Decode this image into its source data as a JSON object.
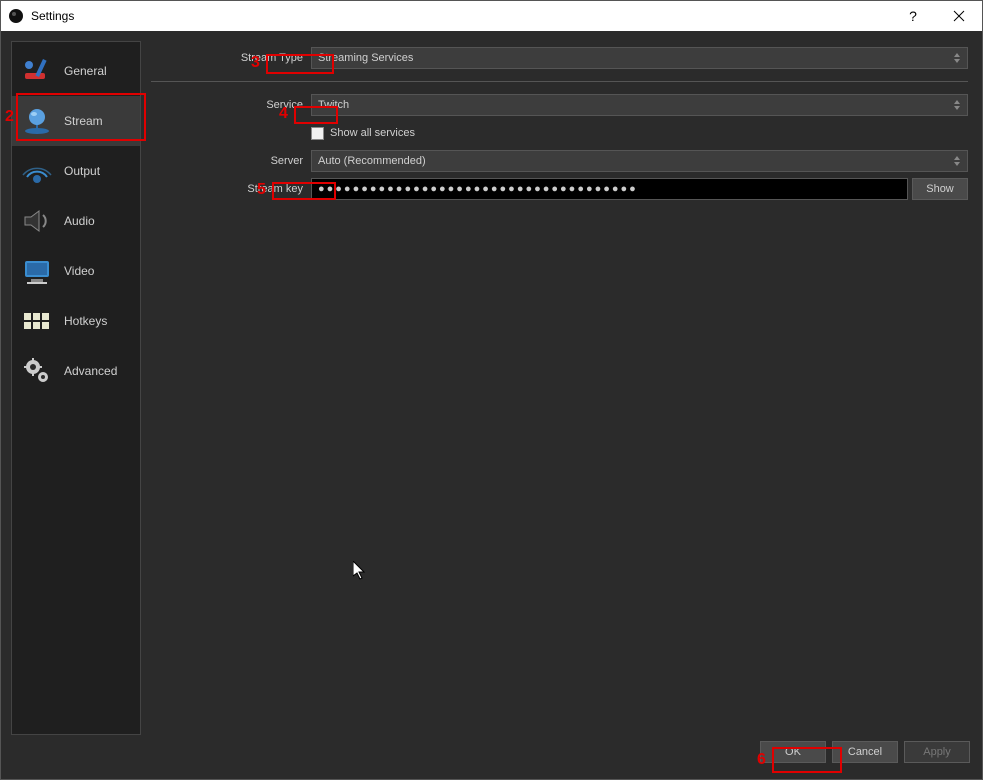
{
  "window": {
    "title": "Settings"
  },
  "sidebar": {
    "items": [
      {
        "label": "General"
      },
      {
        "label": "Stream"
      },
      {
        "label": "Output"
      },
      {
        "label": "Audio"
      },
      {
        "label": "Video"
      },
      {
        "label": "Hotkeys"
      },
      {
        "label": "Advanced"
      }
    ]
  },
  "form": {
    "stream_type_label": "Stream Type",
    "stream_type_value": "Streaming Services",
    "service_label": "Service",
    "service_value": "Twitch",
    "show_all_services_label": "Show all services",
    "server_label": "Server",
    "server_value": "Auto (Recommended)",
    "stream_key_label": "Stream key",
    "stream_key_masked": "●●●●●●●●●●●●●●●●●●●●●●●●●●●●●●●●●●●●●",
    "show_button": "Show"
  },
  "buttons": {
    "ok": "OK",
    "cancel": "Cancel",
    "apply": "Apply"
  },
  "annotations": {
    "n2": "2",
    "n3": "3",
    "n4": "4",
    "n5": "5",
    "n6": "6"
  }
}
